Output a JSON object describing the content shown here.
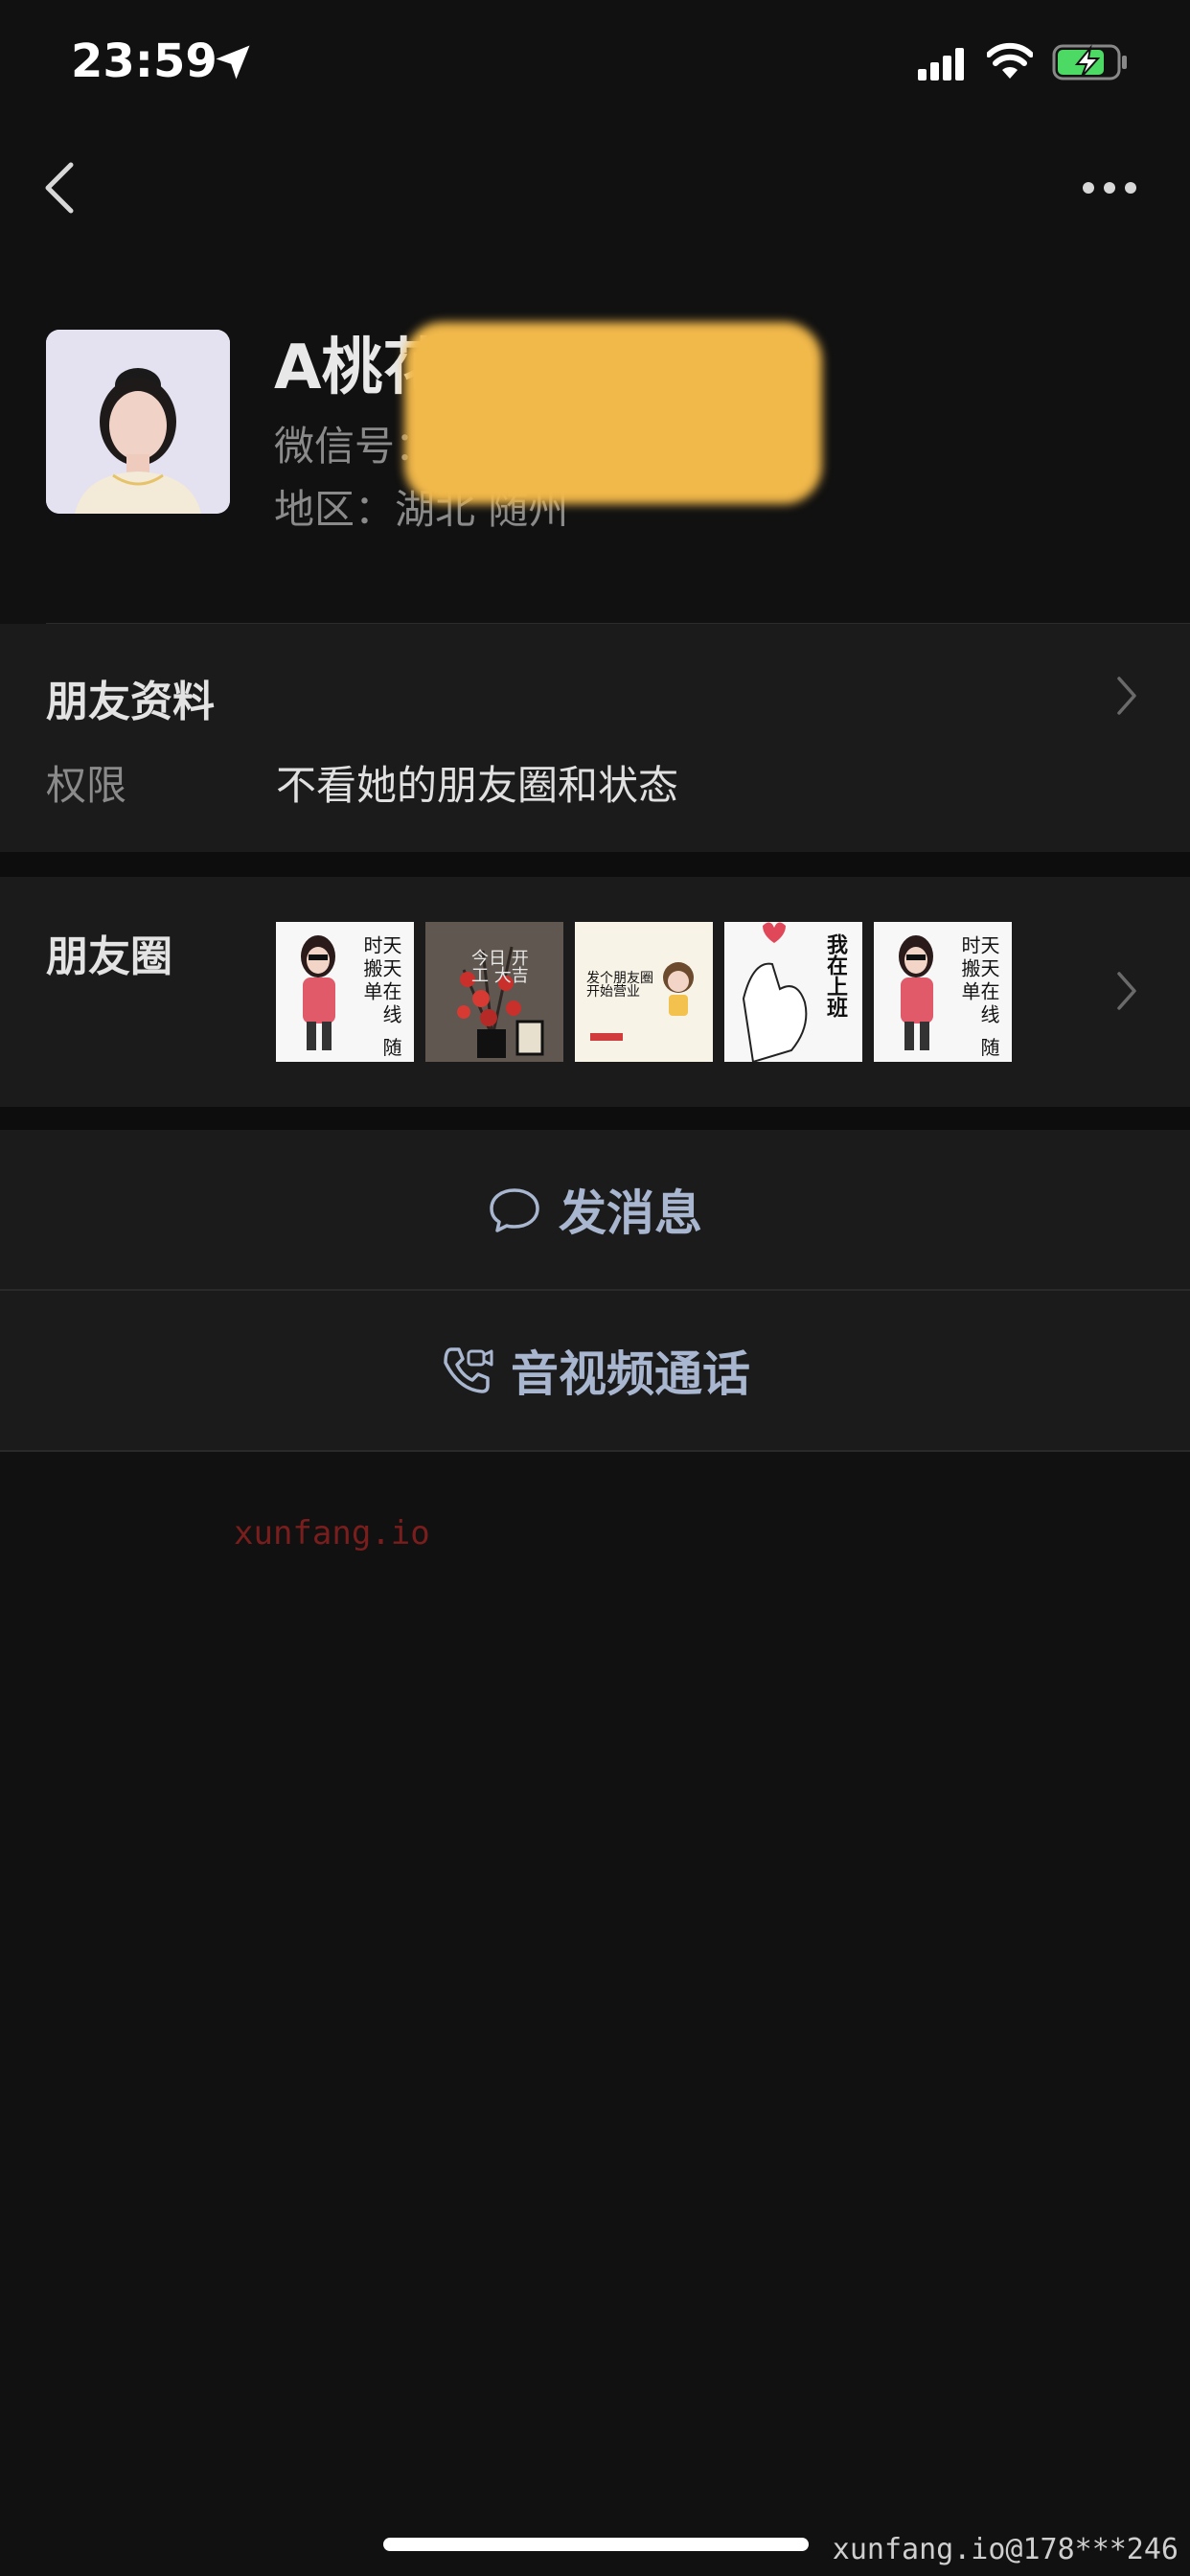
{
  "status_bar": {
    "time": "23:59"
  },
  "profile": {
    "name": "A桃花",
    "wechat_id_label": "微信号：",
    "region": "地区：湖北 随州"
  },
  "friend_info": {
    "title": "朋友资料",
    "permission_label": "权限",
    "permission_value": "不看她的朋友圈和状态"
  },
  "moments": {
    "title": "朋友圈",
    "thumbs": [
      {
        "text": "天天在线 随时搬单"
      },
      {
        "text": "今日 开工 大吉"
      },
      {
        "text": "发个朋友圈 开始营业"
      },
      {
        "text": "我在上班"
      },
      {
        "text": "天天在线 随时搬单"
      }
    ]
  },
  "actions": {
    "message": "发消息",
    "call": "音视频通话"
  },
  "watermark": "xunfang.io",
  "corner_mark": "xunfang.io@178***246",
  "colors": {
    "background": "#111111",
    "section": "#1b1b1b",
    "action_text": "#a8b6cf",
    "redaction": "#f1b84a"
  }
}
